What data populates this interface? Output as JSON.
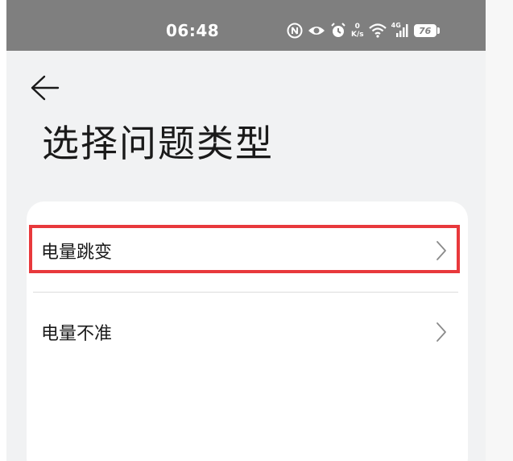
{
  "status_bar": {
    "time": "06:48",
    "net_speed_value": "0",
    "net_speed_unit": "K/s",
    "network_type": "4G",
    "battery_level": "76",
    "icons": [
      "nfc-icon",
      "eye-comfort-icon",
      "alarm-icon",
      "net-speed-icon",
      "wifi-icon",
      "signal-icon",
      "battery-icon"
    ]
  },
  "header": {
    "back_icon": "arrow-left-icon",
    "title": "选择问题类型"
  },
  "list": {
    "items": [
      {
        "label": "电量跳变",
        "icon": "chevron-right-icon",
        "highlighted": true
      },
      {
        "label": "电量不准",
        "icon": "chevron-right-icon",
        "highlighted": false
      }
    ]
  },
  "colors": {
    "status_bar_bg": "#7f7f7f",
    "page_bg": "#f1f2f3",
    "card_bg": "#ffffff",
    "highlight": "#e8393c",
    "text": "#1a1a1a"
  }
}
